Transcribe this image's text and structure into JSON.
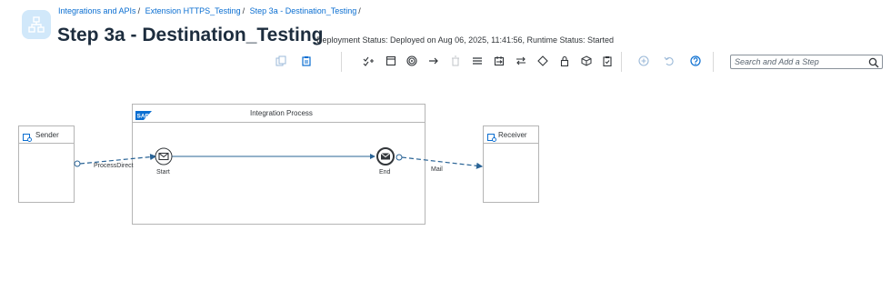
{
  "header": {
    "breadcrumb": [
      {
        "label": "Integrations and APIs"
      },
      {
        "label": "Extension HTTPS_Testing"
      },
      {
        "label": "Step 3a - Destination_Testing"
      }
    ],
    "title": "Step 3a - Destination_Testing",
    "status": "Deployment Status: Deployed on Aug 06, 2025, 11:41:56, Runtime Status: Started",
    "icon": "integration-flow-icon"
  },
  "toolbar": {
    "buttons": [
      {
        "icon": "copy-icon"
      },
      {
        "icon": "paste-icon"
      },
      {
        "icon": "participants-icon"
      },
      {
        "icon": "process-icon"
      },
      {
        "icon": "events-icon"
      },
      {
        "icon": "connection-arrow-icon"
      },
      {
        "icon": "delete-icon"
      },
      {
        "icon": "call-icon"
      },
      {
        "icon": "routing-icon"
      },
      {
        "icon": "transformation-icon"
      },
      {
        "icon": "gateway-icon"
      },
      {
        "icon": "security-icon"
      },
      {
        "icon": "persistence-icon"
      },
      {
        "icon": "validator-icon"
      },
      {
        "icon": "zoom-in-icon"
      },
      {
        "icon": "undo-icon"
      },
      {
        "icon": "help-icon"
      }
    ],
    "search_placeholder": "Search and Add a Step"
  },
  "diagram": {
    "sender": {
      "label": "Sender"
    },
    "receiver": {
      "label": "Receiver"
    },
    "process": {
      "label": "Integration Process",
      "logo": "SAP"
    },
    "start_event": {
      "label": "Start"
    },
    "end_event": {
      "label": "End"
    },
    "sender_flow": {
      "label": "ProcessDirect"
    },
    "receiver_flow": {
      "label": "Mail"
    }
  },
  "colors": {
    "link": "#0a6ed1",
    "flow": "#2a6496",
    "pool_border": "#b5b5b5",
    "header_icon_bg": "#d1e8fa"
  }
}
